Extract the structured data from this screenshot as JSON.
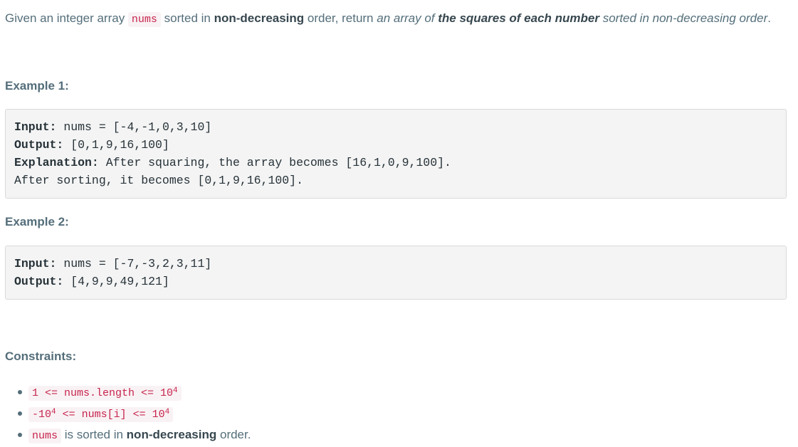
{
  "description": {
    "p1": "Given an integer array ",
    "code1": "nums",
    "p2": " sorted in ",
    "bold1": "non-decreasing",
    "p3": " order, return ",
    "italic1": "an array of ",
    "bold2": "the squares of each number",
    "italic2": " sorted in non-decreasing order",
    "p4": "."
  },
  "examples": [
    {
      "heading": "Example 1:",
      "input_label": "Input:",
      "input_value": " nums = [-4,-1,0,3,10]",
      "output_label": "Output:",
      "output_value": " [0,1,9,16,100]",
      "explanation_label": "Explanation:",
      "explanation_value": " After squaring, the array becomes [16,1,0,9,100].",
      "explanation_value2": "After sorting, it becomes [0,1,9,16,100]."
    },
    {
      "heading": "Example 2:",
      "input_label": "Input:",
      "input_value": " nums = [-7,-3,2,3,11]",
      "output_label": "Output:",
      "output_value": " [4,9,9,49,121]"
    }
  ],
  "constraints": {
    "heading": "Constraints:",
    "c1_code": "1 <= nums.length <= 10",
    "c1_exp": "4",
    "c2_code_a": "-10",
    "c2_exp_a": "4",
    "c2_code_b": " <= nums[i] <= 10",
    "c2_exp_b": "4",
    "c3_code": "nums",
    "c3_text1": " is sorted in ",
    "c3_bold": "non-decreasing",
    "c3_text2": " order."
  }
}
